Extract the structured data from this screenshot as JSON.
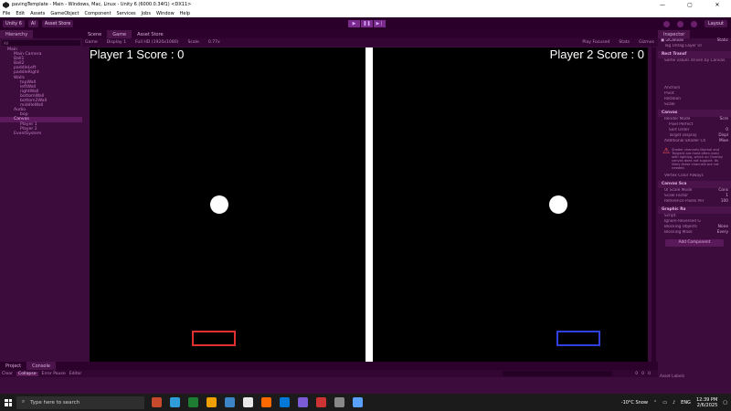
{
  "window": {
    "title": "pavingTemplate - Main - Windows, Mac, Linux - Unity 6 (6000.0.34f1) <DX11>",
    "buttons": [
      "—",
      "▢",
      "✕"
    ]
  },
  "menu": [
    "File",
    "Edit",
    "Assets",
    "GameObject",
    "Component",
    "Services",
    "Jobs",
    "Window",
    "Help"
  ],
  "toolbar": {
    "account": "Unity 6",
    "cloud": "AI",
    "asset_store": "Asset Store",
    "layout": "Layout"
  },
  "hierarchy": {
    "tab": "Hierarchy",
    "search_placeholder": "All",
    "items": [
      "Main",
      "Main Camera",
      "Ball1",
      "Ball2",
      "paddleLeft",
      "paddleRight",
      "Walls",
      "topWall",
      "leftWall",
      "rightWall",
      "bottomWall",
      "bottom2Wall",
      "middleWall",
      "Audio",
      "bop",
      "Canvas",
      "Player 1",
      "Player 2",
      "EventSystem"
    ],
    "selected_index": 15
  },
  "game_tabs": [
    "Scene",
    "Game",
    "Asset Store"
  ],
  "game_toolbar": {
    "view": "Game",
    "display": "Display 1",
    "resolution": "Full HD (1920x1080)",
    "scale_label": "Scale",
    "scale_value": "0.77x",
    "play_mode": "Play Focused",
    "stats": "Stats",
    "gizmos": "Gizmos"
  },
  "game": {
    "player1_score": "Player 1 Score : 0",
    "player2_score": "Player 2 Score : 0",
    "paddle_left_color": "#e03030",
    "paddle_right_color": "#3040e0",
    "ball_color": "#ffffff",
    "divider_color": "#ffffff"
  },
  "inspector": {
    "tab": "Inspector",
    "object_name": "Canvas",
    "static_label": "Static",
    "tag_label": "Tag",
    "tag_value": "Untag",
    "layer_label": "Layer",
    "layer_value": "UI",
    "sections": {
      "rect_transform": "Rect Transf",
      "rect_note": "Some values driven by Canvas.",
      "anchors": "Anchors",
      "pivot": "Pivot",
      "rotation": "Rotation",
      "scale": "Scale",
      "canvas": "Canvas",
      "render_mode": "Render Mode",
      "render_mode_value": "Scre",
      "pixel_perfect": "Pixel Perfect",
      "sort_order": "Sort Order",
      "sort_order_value": "0",
      "target_display": "Target Display",
      "target_display_value": "Displ",
      "additional_shader": "Additional Shader Ch",
      "additional_shader_value": "Mixe",
      "warning": "Shader channels Normal and Tangent are most often used with lighting, which an Overlay canvas does not support. Its likely these channels are not needed.",
      "vertex_color": "Vertex Color Always",
      "canvas_scaler": "Canvas Sca",
      "ui_scale_mode": "UI Scale Mode",
      "ui_scale_mode_value": "Cons",
      "scale_factor": "Scale Factor",
      "scale_factor_value": "1",
      "ref_pixels": "Reference Pixels Per",
      "ref_pixels_value": "100",
      "graphic_raycaster": "Graphic Ra",
      "script": "Script",
      "ignore_reversed": "Ignore Reversed G",
      "blocking_objects": "Blocking Objects",
      "blocking_objects_value": "None",
      "blocking_mask": "Blocking Mask",
      "blocking_mask_value": "Every",
      "add_component": "Add Component",
      "asset_labels": "Asset Labels"
    }
  },
  "console": {
    "tabs": [
      "Project",
      "Console"
    ],
    "buttons": [
      "Clear",
      "Collapse",
      "Error Pause",
      "Editor"
    ],
    "counts": [
      "0",
      "0",
      "0"
    ]
  },
  "taskbar": {
    "search_placeholder": "Type here to search",
    "weather": "-10°C  Snow",
    "language": "ENG",
    "time": "12:39 PM",
    "date": "2/6/2025",
    "app_colors": [
      "#c64a2b",
      "#2f9dd7",
      "#1e7d32",
      "#f0a000",
      "#3d85c6",
      "#e8e8e8",
      "#ff6a00",
      "#0078d7",
      "#7b5cd6",
      "#cc3333",
      "#888888",
      "#5aa0ff"
    ]
  }
}
